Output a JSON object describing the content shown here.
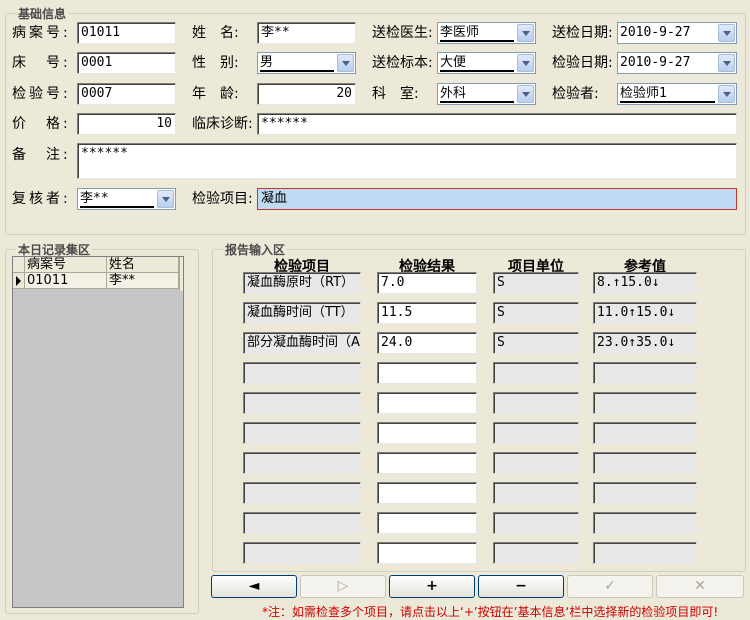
{
  "basic_info": {
    "legend": "基础信息",
    "case_no": {
      "label": "病案号:",
      "value": "01011"
    },
    "name": {
      "label": "姓　名:",
      "value": "李**"
    },
    "doctor": {
      "label": "送检医生:",
      "value": "李医师"
    },
    "send_date": {
      "label": "送检日期:",
      "value": "2010-9-27"
    },
    "bed_no": {
      "label": "床　号:",
      "value": "0001"
    },
    "gender": {
      "label": "性　别:",
      "value": "男"
    },
    "specimen": {
      "label": "送检标本:",
      "value": "大便"
    },
    "test_date": {
      "label": "检验日期:",
      "value": "2010-9-27"
    },
    "test_no": {
      "label": "检验号:",
      "value": "0007"
    },
    "age": {
      "label": "年　龄:",
      "value": "20"
    },
    "dept": {
      "label": "科　室:",
      "value": "外科"
    },
    "tester": {
      "label": "检验者:",
      "value": "检验师1"
    },
    "price": {
      "label": "价　格:",
      "value": "10"
    },
    "diagnosis": {
      "label": "临床诊断:",
      "value": "******"
    },
    "remark": {
      "label": "备　注:",
      "value": "******"
    },
    "reviewer": {
      "label": "复核者:",
      "value": "李**"
    },
    "test_item": {
      "label": "检验项目:",
      "value": "凝血"
    }
  },
  "records": {
    "legend": "本日记录集区",
    "columns": [
      "病案号",
      "姓名"
    ],
    "rows": [
      {
        "case_no": "01011",
        "name": "李**"
      }
    ]
  },
  "report": {
    "legend": "报告输入区",
    "columns": [
      "检验项目",
      "检验结果",
      "项目单位",
      "参考值"
    ],
    "rows": [
      {
        "item": "凝血酶原时（RT）",
        "result": "7.0",
        "unit": "S",
        "ref": "8.↑15.0↓"
      },
      {
        "item": "凝血酶时间（TT）",
        "result": "11.5",
        "unit": "S",
        "ref": "11.0↑15.0↓"
      },
      {
        "item": "部分凝血酶时间（A",
        "result": "24.0",
        "unit": "S",
        "ref": "23.0↑35.0↓"
      },
      {
        "item": "",
        "result": "",
        "unit": "",
        "ref": ""
      },
      {
        "item": "",
        "result": "",
        "unit": "",
        "ref": ""
      },
      {
        "item": "",
        "result": "",
        "unit": "",
        "ref": ""
      },
      {
        "item": "",
        "result": "",
        "unit": "",
        "ref": ""
      },
      {
        "item": "",
        "result": "",
        "unit": "",
        "ref": ""
      },
      {
        "item": "",
        "result": "",
        "unit": "",
        "ref": ""
      },
      {
        "item": "",
        "result": "",
        "unit": "",
        "ref": ""
      }
    ]
  },
  "buttons": {
    "prev": "◄",
    "next": "▷",
    "add": "+",
    "remove": "−",
    "confirm": "✓",
    "cancel": "✕"
  },
  "note": "*注：如需检查多个项目，请点击以上‘+’按钮在’基本信息‘栏中选择新的检验项目即可!"
}
